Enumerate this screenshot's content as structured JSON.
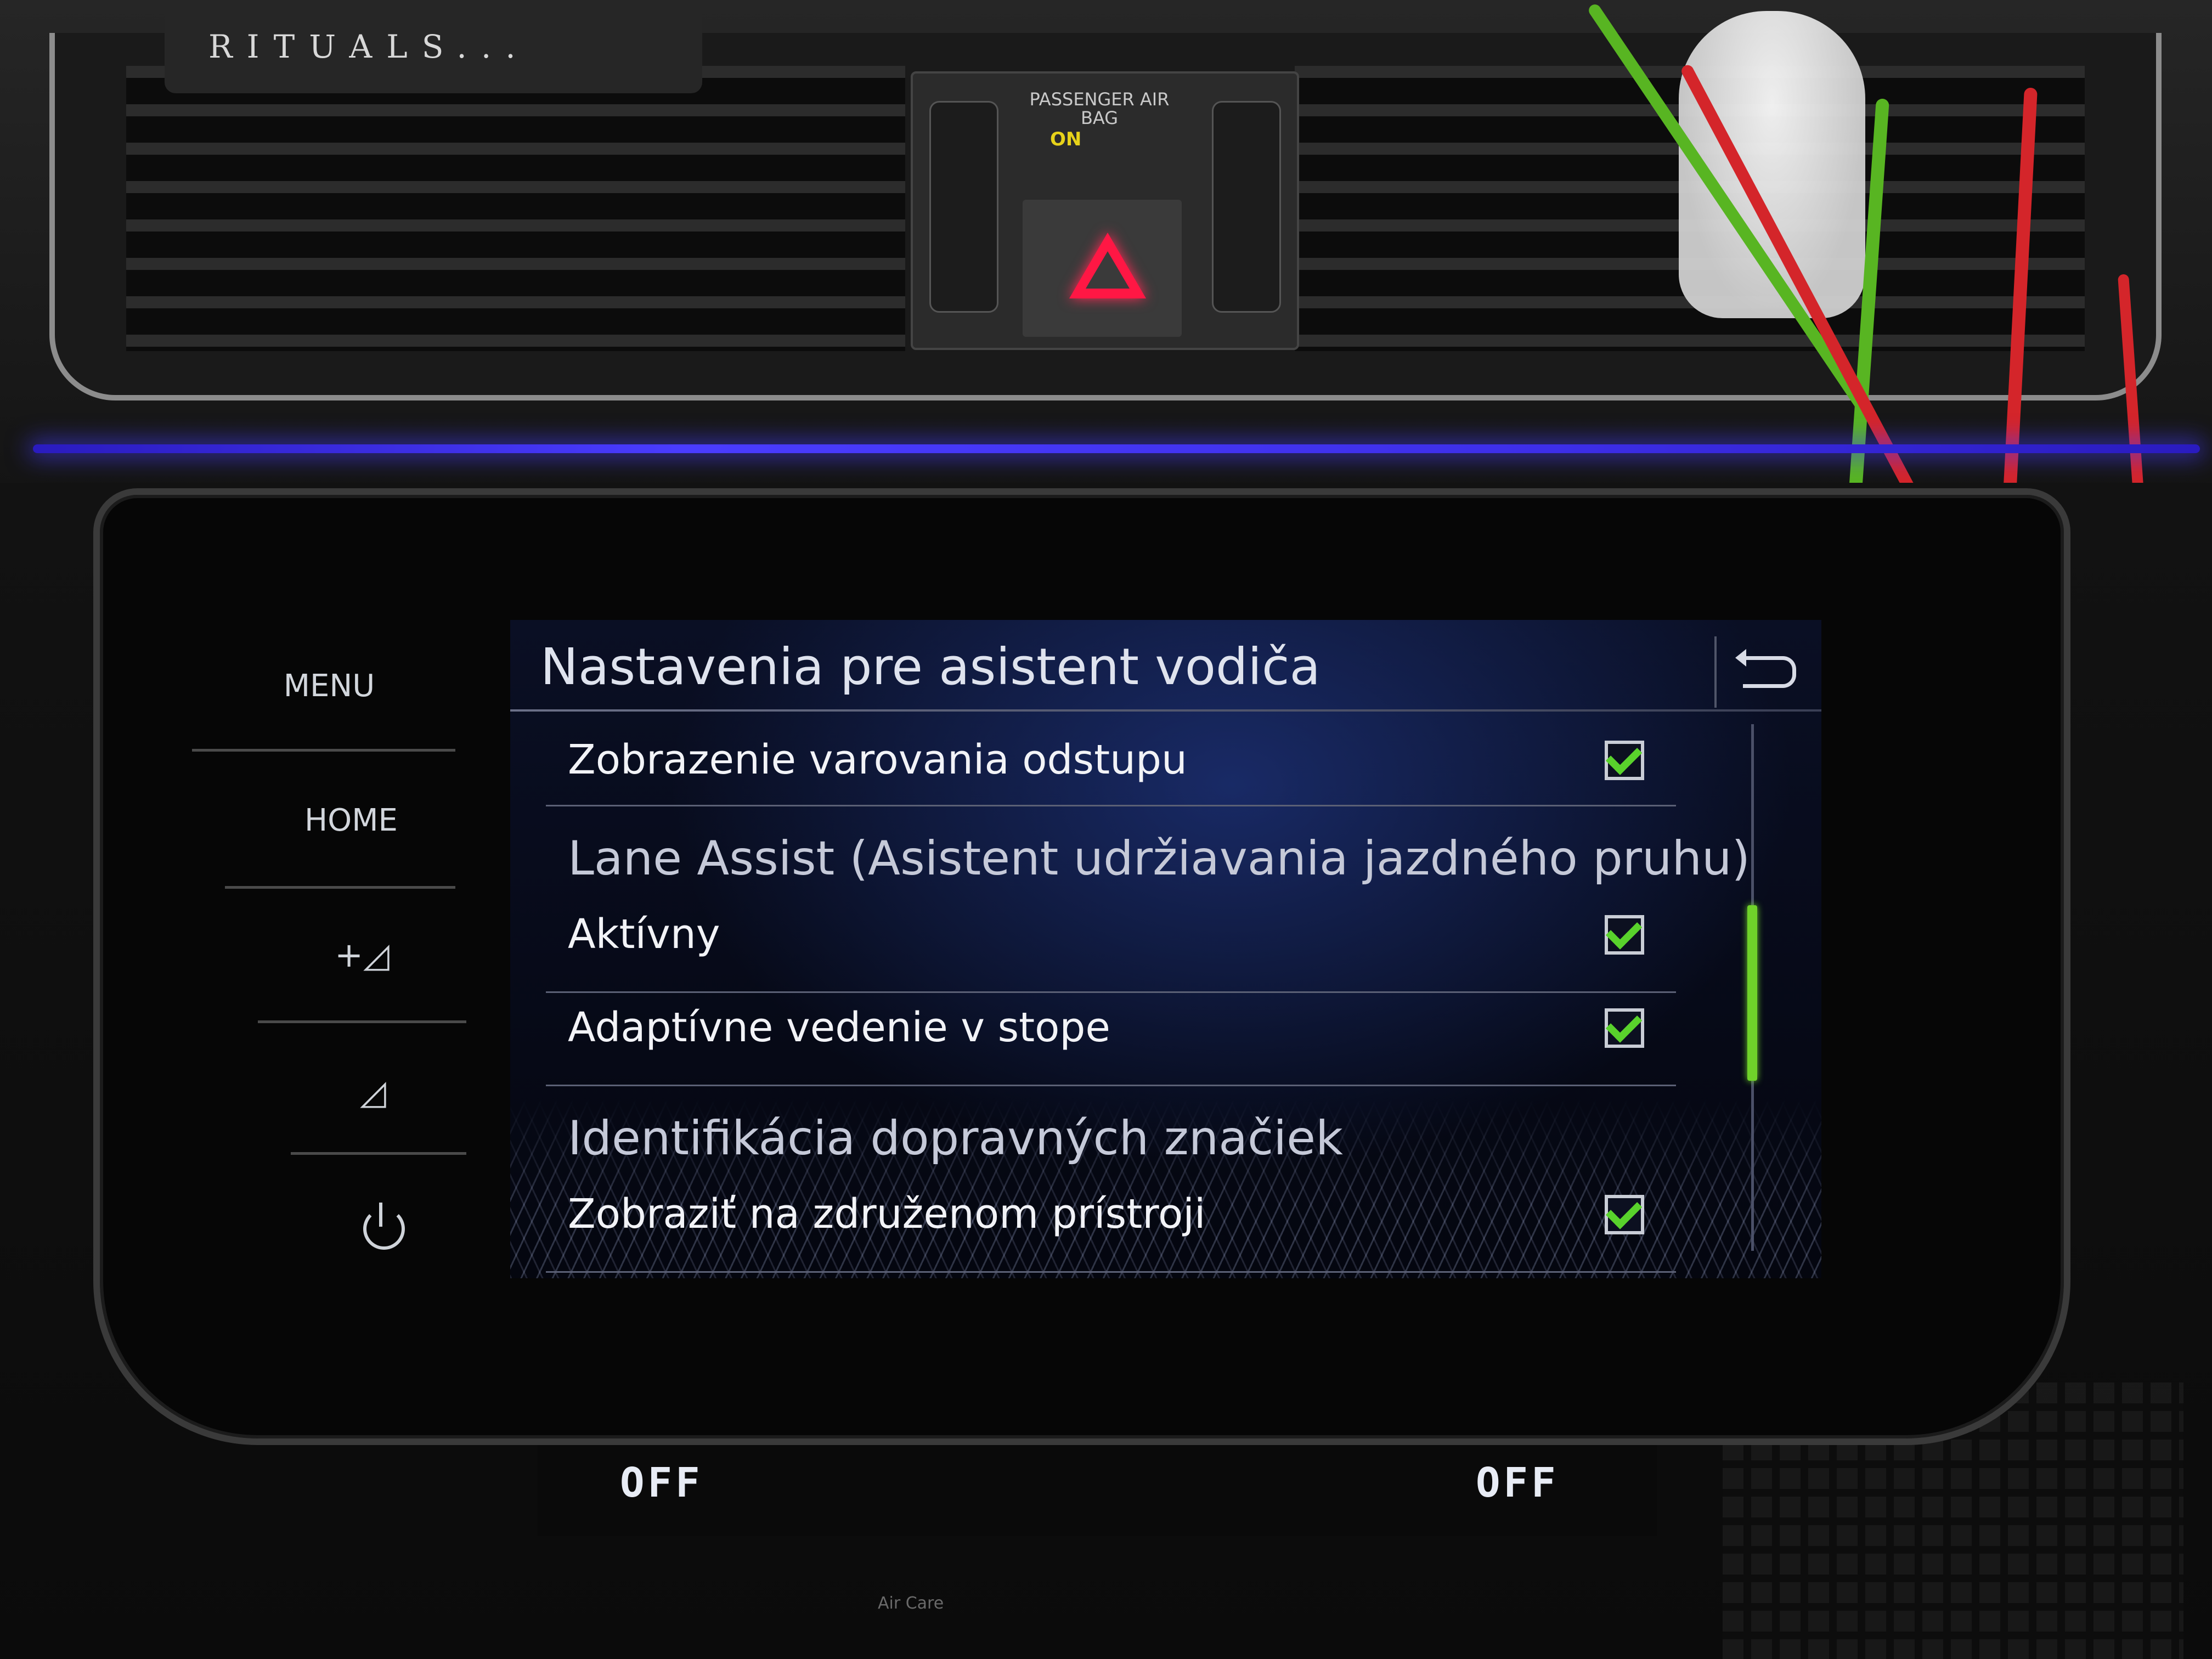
{
  "environment": {
    "rituals_label": "RITUALS...",
    "airbag_label": "PASSENGER AIR BAG",
    "airbag_status": "ON",
    "left_temperature": "OFF",
    "right_temperature": "OFF",
    "aircare_label": "Air Care",
    "colors": {
      "ambient": "#3d2ee8",
      "hazard": "#ff1744",
      "airbag_indicator": "#e7d21a"
    }
  },
  "hard_keys": {
    "menu_label": "MENU",
    "home_label": "HOME",
    "volume_up_icon": "volume-up-icon",
    "volume_down_icon": "volume-down-icon",
    "power_icon": "power-icon"
  },
  "screen": {
    "title": "Nastavenia pre asistent vodiča",
    "back_icon": "back-arrow-icon",
    "items": [
      {
        "label": "Zobrazenie varovania odstupu",
        "checked": true
      },
      {
        "section": "Lane Assist (Asistent udržiavania jazdného pruhu)"
      },
      {
        "label": "Aktívny",
        "checked": true
      },
      {
        "label": "Adaptívne vedenie v stope",
        "checked": true
      },
      {
        "section": "Identifikácia dopravných značiek"
      },
      {
        "label": "Zobraziť na združenom prístroji",
        "checked": true
      }
    ],
    "scroll_position": 0.4,
    "colors": {
      "accent": "#59d22c",
      "scrollbar": "#6fd22a",
      "text": "#f2f3f7"
    }
  }
}
